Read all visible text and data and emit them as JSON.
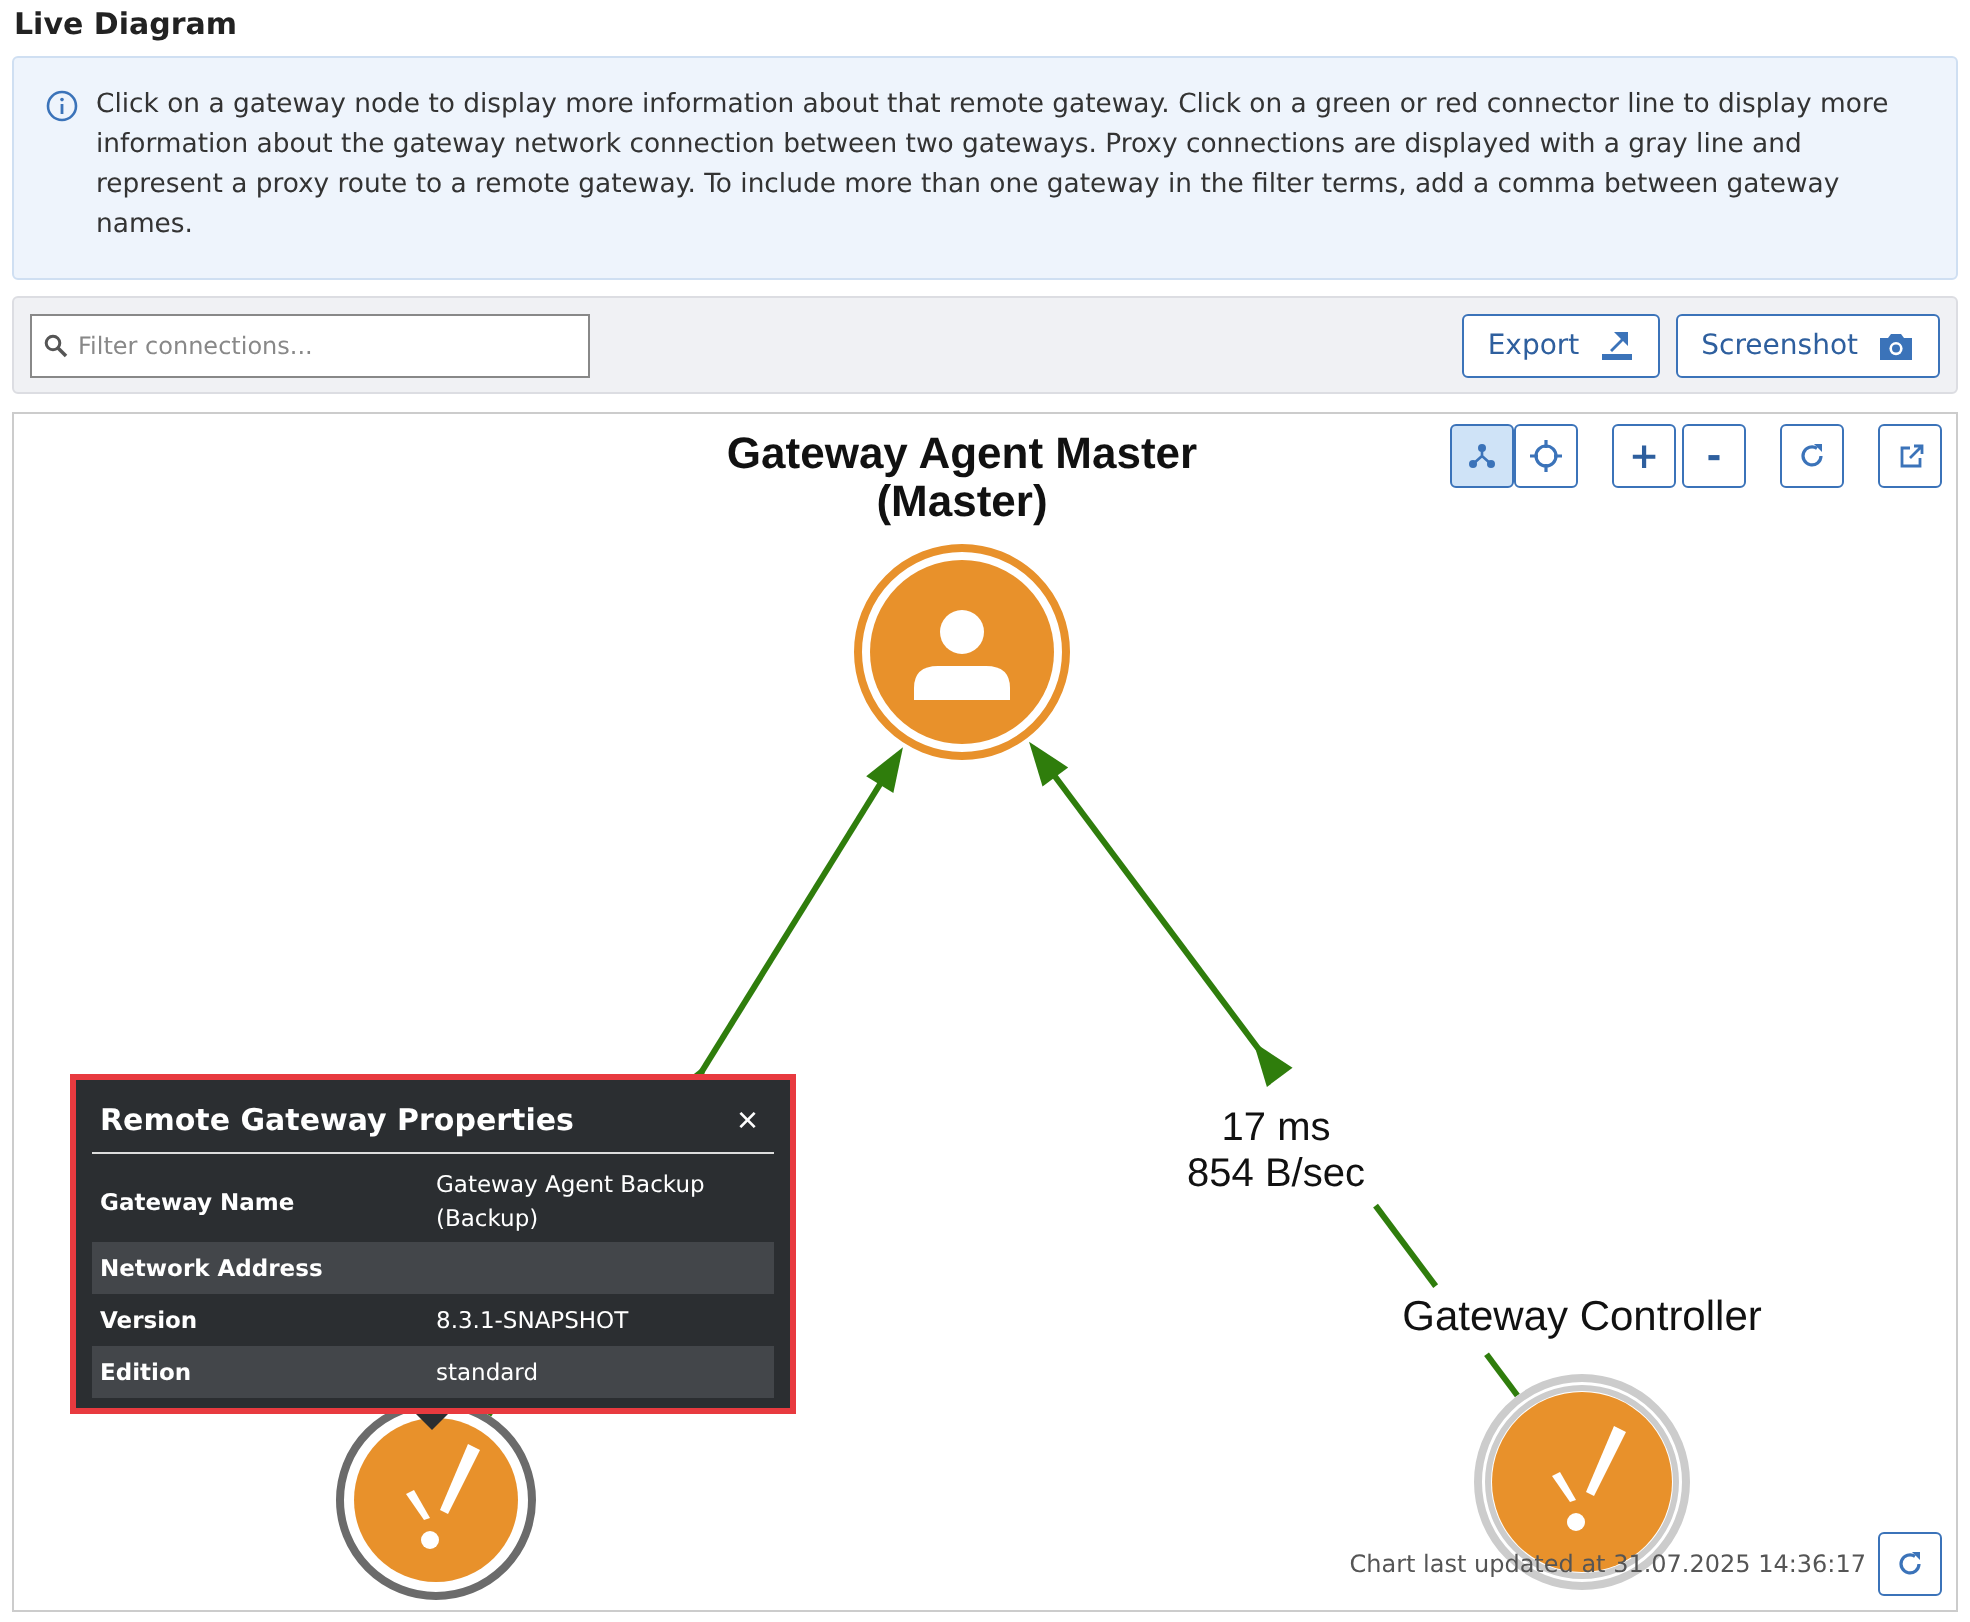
{
  "page_title": "Live Diagram",
  "info": "Click on a gateway node to display more information about that remote gateway. Click on a green or red connector line to display more information about the gateway network connection between two gateways. Proxy connections are displayed with a gray line and represent a proxy route to a remote gateway. To include more than one gateway in the filter terms, add a comma between gateway names.",
  "toolbar": {
    "search": {
      "placeholder": "Filter connections..."
    },
    "buttons": [
      {
        "label": "Export",
        "kind": "export"
      },
      {
        "label": "Screenshot",
        "kind": "screenshot"
      }
    ]
  },
  "diagram": {
    "tools": [
      {
        "kind": "layout",
        "selected": true
      },
      {
        "kind": "center",
        "selected": false
      },
      {
        "label": "+",
        "kind": "zoomin",
        "selected": false
      },
      {
        "label": "-",
        "kind": "zoomout",
        "selected": false
      },
      {
        "kind": "reload",
        "selected": false
      },
      {
        "kind": "popout",
        "selected": false
      }
    ],
    "nodes": [
      {
        "name": "Gateway Agent Master",
        "role": "(Master)",
        "color": "#e8912b",
        "kind": "master"
      },
      {
        "color": "#6b6b6b",
        "kind": "remote"
      },
      {
        "name": "Gateway Controller",
        "color": "#cccccc",
        "kind": "remote"
      }
    ],
    "edges": [
      {
        "color": "#2f7d0c"
      },
      {
        "color": "#2f7d0c",
        "latency": "17 ms",
        "throughput": "854 B/sec"
      }
    ],
    "popup": {
      "title": "Remote Gateway Properties",
      "close": "×",
      "rows": [
        {
          "label": "Gateway Name",
          "value": "Gateway Agent Backup (Backup)"
        },
        {
          "label": "Network Address"
        },
        {
          "label": "Version",
          "value": "8.3.1-SNAPSHOT"
        },
        {
          "label": "Edition",
          "value": "standard"
        }
      ]
    },
    "updated": "Chart last updated at 31.07.2025 14:36:17"
  }
}
